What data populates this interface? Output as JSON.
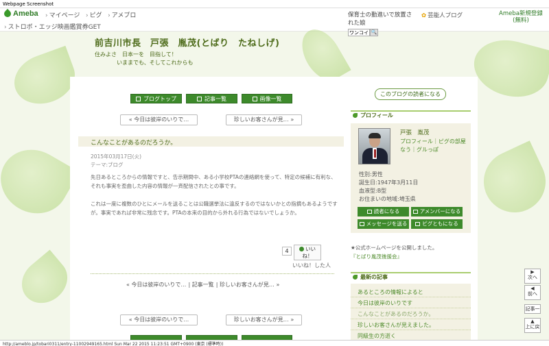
{
  "screenshot_label": "Webpage Screenshot",
  "header": {
    "logo": "Ameba",
    "nav": [
      "マイページ",
      "ピグ",
      "アメブロ"
    ],
    "nav2": "ストロボ・エッジ映画鑑賞券GET",
    "ticker": "保育士の勤進いで放置された娘",
    "ticker_link": "芸能人ブログ",
    "signup": "Ameba新規登録\n(無料)",
    "search_placeholder": "ワンコイン",
    "search_button": "🔍"
  },
  "blog": {
    "title": "前吉川市長　戸張　胤茂(とばり　たねしげ)",
    "subtitle1": "住みよさ　日本一を　目指して！",
    "subtitle2": "いままでも、そしてこれからも"
  },
  "buttons": {
    "blog_top": "ブログトップ",
    "article_list": "記事一覧",
    "image_list": "画像一覧"
  },
  "pager": {
    "prev": "«  今日は彼岸のいりで…",
    "next": "珍しいお客さんが見…  »"
  },
  "entry": {
    "title": "こんなことがあるのだろうか。",
    "date": "2015年03月17日(火)",
    "theme": "テーマ:ブログ",
    "para1": "先日あるところからの情報ですと、告示期間中、ある小学校PTAの連絡網を使って、特定の候補に有利な、それも事実を歪曲した内容の情報が一斉配信されたとの事です。",
    "para2": "これは一度に複数のひとにメールを送ることは公職選挙法に違反するのではないかとの指摘もあるようですが。事実であれば非常に残念です。PTAの本来の目的から外れる行為ではないでしょうか。",
    "like_count": "4",
    "like_label": "いいね！",
    "like_users": "いいね！した人"
  },
  "bottom_nav": {
    "prev": "« 今日は彼岸のいりで…",
    "list": "記事一覧",
    "next": "珍しいお客さんが見… »"
  },
  "sidebar": {
    "reader_button": "このブログの読者になる",
    "profile_heading": "プロフィール",
    "profile_name": "戸張　胤茂",
    "profile_links": "プロフィール｜ピグの部屋\nなう｜グルっぽ",
    "gender": "性別:男性",
    "birthday": "誕生日:1947年3月11日",
    "blood": "血液型:B型",
    "location": "お住まいの地域:埼玉県",
    "btn_reader": "読者になる",
    "btn_amember": "アメンバーになる",
    "btn_message": "メッセージを送る",
    "btn_pig": "ピグともになる",
    "notice": "★公式ホームページを公開しました。",
    "notice_link": "『とばり胤茂後援会』",
    "recent_heading": "最新の記事",
    "recent": [
      "あるところの情報によると",
      "今日は彼岸のいりです",
      "こんなことがあるのだろうか。",
      "珍しいお客さんが見えました。",
      "同級生の方逝く"
    ]
  },
  "float_nav": {
    "next": "次へ",
    "prev": "前へ",
    "list": "記事一",
    "top": "上に戻"
  },
  "status_bar": "http://ameblo.jp/tobari0311/entry-11002949165.html Sun Mar 22 2015 11:23:51 GMT+0900 (東京 (標準時))"
}
